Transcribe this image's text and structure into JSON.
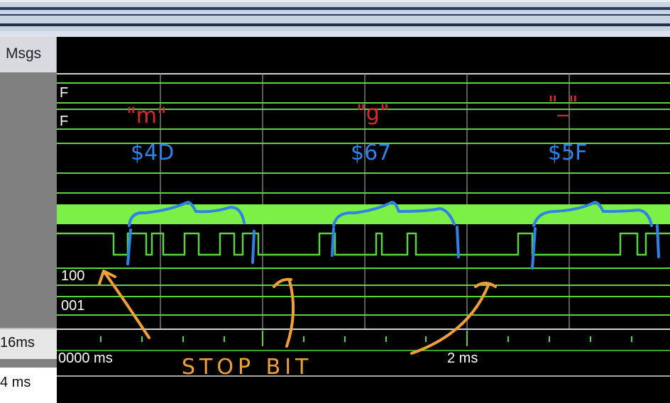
{
  "name_column": {
    "header": "Msgs",
    "now_value": "16ms",
    "cursor_value": "4 ms"
  },
  "signals": {
    "row1_value": "F",
    "row2_value": "F",
    "bus1_value": "100",
    "bus2_value": "001"
  },
  "timeline": {
    "start_label": "0000 ms",
    "mid_label": "2 ms"
  },
  "annotations": {
    "char1": "\"m\"",
    "hex1": "$4D",
    "char2": "\"g\"",
    "hex2": "$67",
    "char3": "\"_\"",
    "hex3": "$5F",
    "stop_bit": "STOP BIT"
  },
  "colors": {
    "wave_green": "#5bd33d",
    "highlight_green": "#7cf046",
    "annot_red": "#d92b2b",
    "annot_blue": "#2e82e8",
    "annot_orange": "#f0a035"
  }
}
